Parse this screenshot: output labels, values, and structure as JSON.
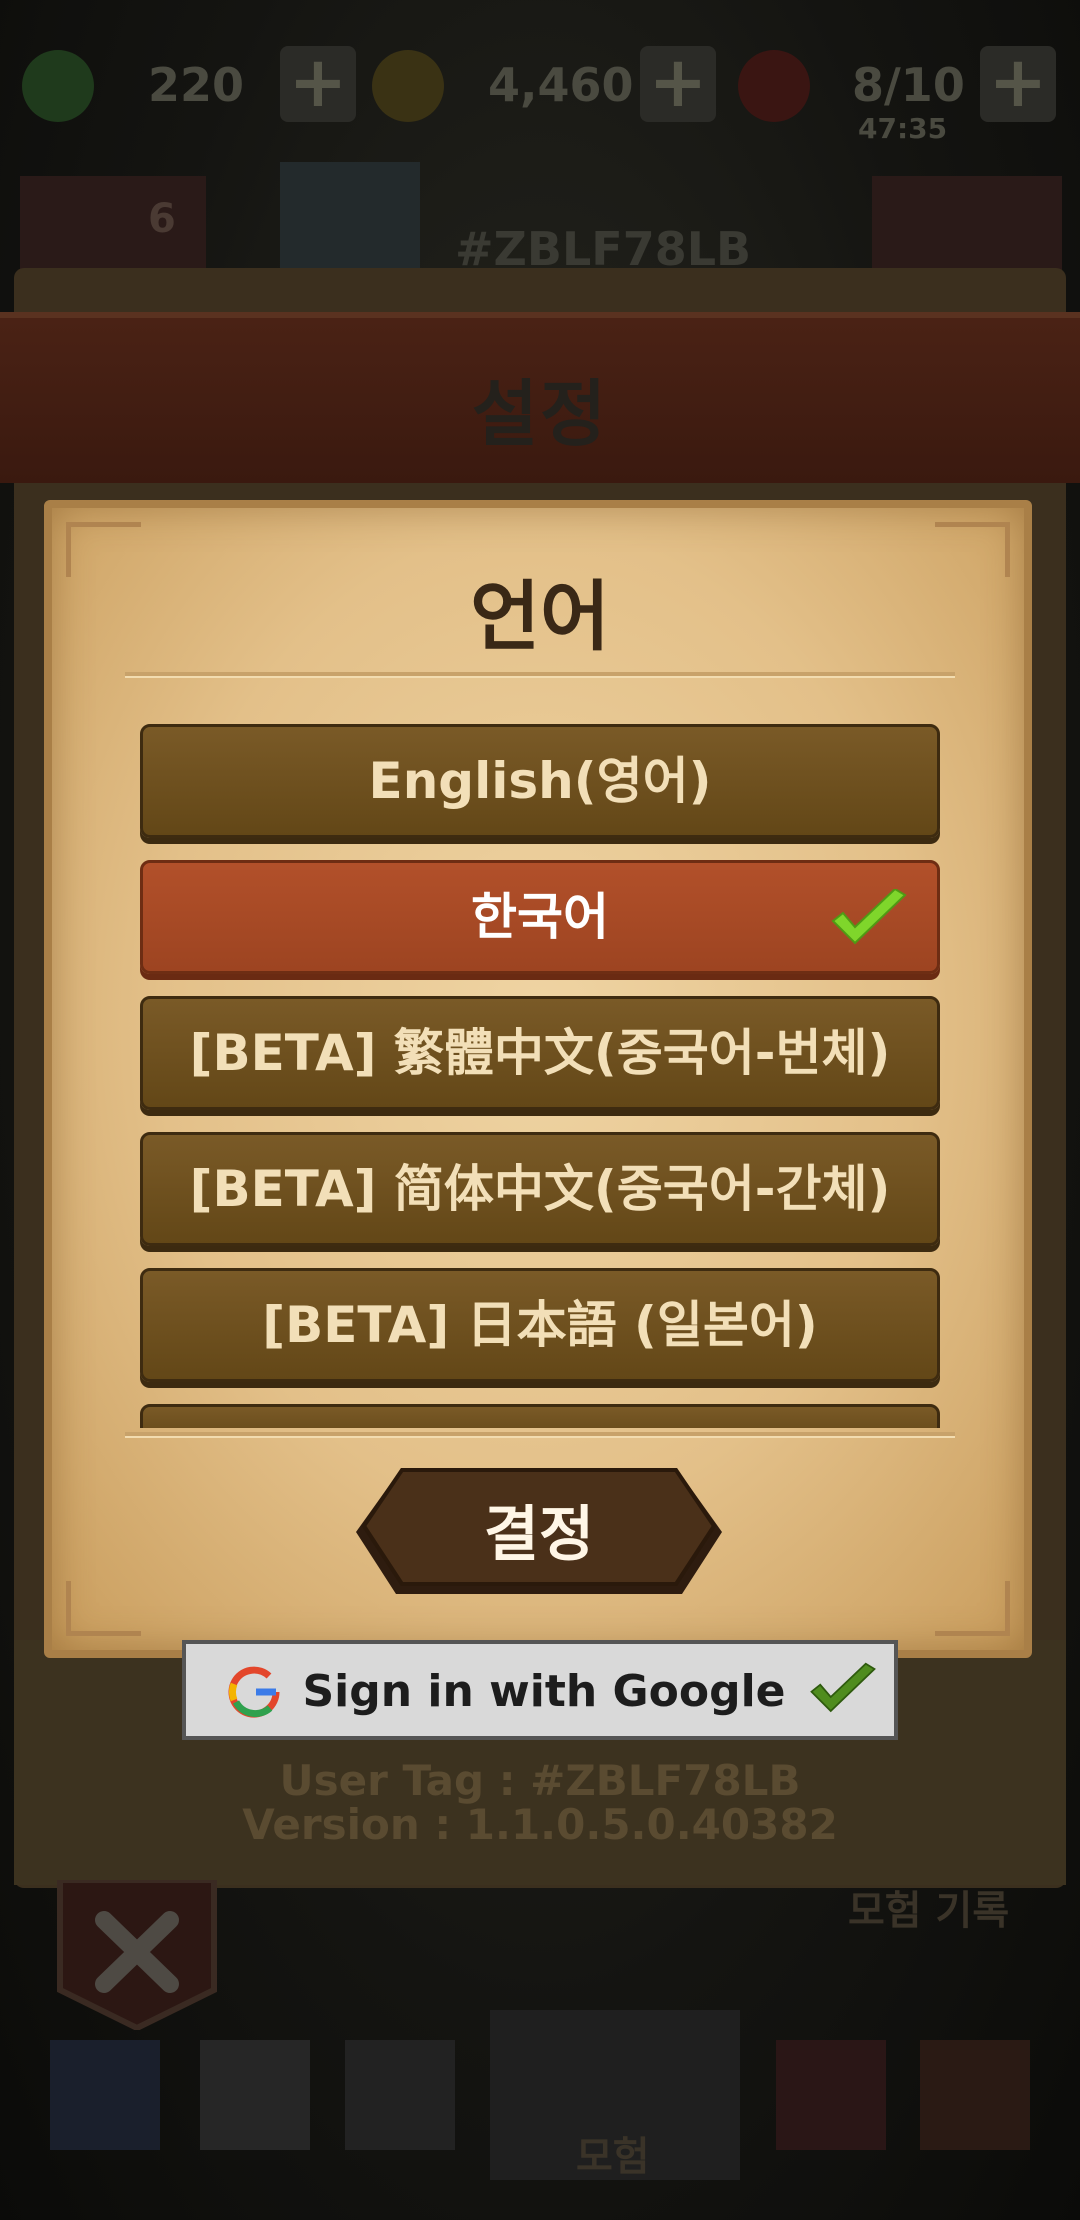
{
  "hud": {
    "gems": "220",
    "gold": "4,460",
    "stamina": "8/10",
    "stamina_timer": "47:35",
    "mail_count": "6",
    "player_tag": "#ZBLF78LB"
  },
  "settings": {
    "title": "설정",
    "section_title": "언어",
    "languages": [
      {
        "label": "English(영어)",
        "selected": false
      },
      {
        "label": "한국어",
        "selected": true
      },
      {
        "label": "[BETA] 繁體中文(중국어-번체)",
        "selected": false
      },
      {
        "label": "[BETA] 简体中文(중국어-간체)",
        "selected": false
      },
      {
        "label": "[BETA] 日本語 (일본어)",
        "selected": false
      }
    ],
    "confirm_label": "결정",
    "google_label": "Sign in with Google",
    "user_tag": "User Tag : #ZBLF78LB",
    "version": "Version : 1.1.0.5.0.40382"
  },
  "bottom_nav": {
    "adventure_log": "모험 기록",
    "adventure": "모험"
  },
  "colors": {
    "selected": "#a9472a",
    "button": "#6e5020",
    "check": "#7fd62b",
    "parchment": "#e6c48d"
  }
}
